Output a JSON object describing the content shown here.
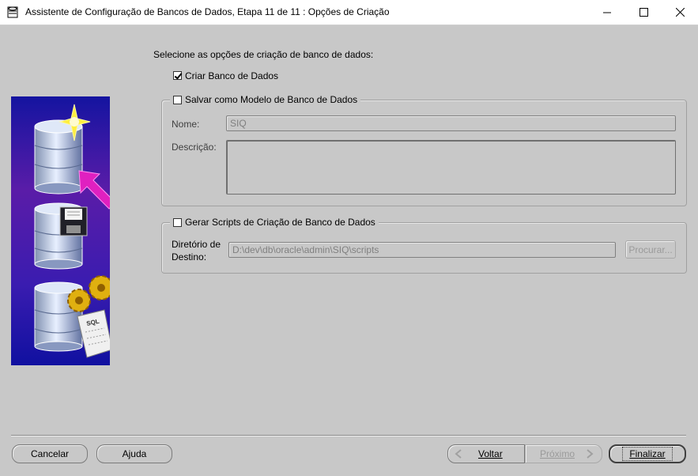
{
  "window": {
    "title": "Assistente de Configuração de Bancos de Dados, Etapa 11 de 11 : Opções de Criação",
    "minimize": "–",
    "maximize": "☐",
    "close": "✕"
  },
  "prompt": "Selecione as opções de criação de banco de dados:",
  "create_db": {
    "label": "Criar Banco de Dados",
    "checked": true
  },
  "template_group": {
    "label": "Salvar como Modelo de Banco de Dados",
    "checked": false,
    "name_label": "Nome:",
    "name_value": "SIQ",
    "description_label": "Descrição:",
    "description_value": ""
  },
  "scripts_group": {
    "label": "Gerar Scripts de Criação de Banco de Dados",
    "checked": false,
    "dir_label_line1": "Diretório de",
    "dir_label_line2": "Destino:",
    "dir_value": "D:\\dev\\db\\oracle\\admin\\SIQ\\scripts",
    "browse_label": "Procurar..."
  },
  "buttons": {
    "cancel": "Cancelar",
    "help": "Ajuda",
    "back": "Voltar",
    "next": "Próximo",
    "finish": "Finalizar"
  },
  "icons": [
    "database-icon",
    "sparkle-icon",
    "arrow-icon",
    "floppy-icon",
    "gear-icon",
    "sql-scroll-icon",
    "chevron-left-icon",
    "chevron-right-icon"
  ],
  "colors": {
    "art_background_top": "#1a1a9a",
    "art_background_mid": "#5a1aa0",
    "arrow": "#e020c0",
    "gear": "#e0b010"
  }
}
